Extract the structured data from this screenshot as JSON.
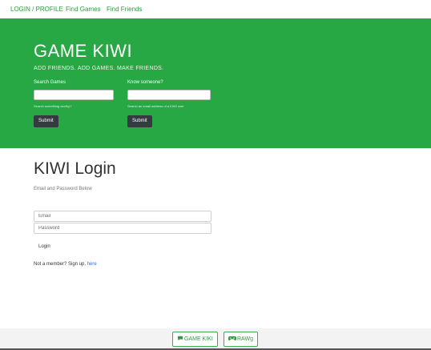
{
  "nav": {
    "items": [
      "LOGIN / PROFILE",
      "Find Games",
      "Find Friends"
    ]
  },
  "hero": {
    "title": "GAME KIWI",
    "subtitle": "ADD FRIENDS. ADD GAMES. MAKE FRIENDS.",
    "search_games": {
      "label": "Search Games",
      "help": "Search something worthy?",
      "submit": "Submit"
    },
    "know_someone": {
      "label": "Know someone?",
      "help": "Search an email address of a KIWI user",
      "submit": "Submit"
    }
  },
  "login": {
    "title": "KIWI Login",
    "subtitle": "Email and Password Below",
    "email_placeholder": "Email",
    "password_placeholder": "Password",
    "login_label": "Login",
    "signup_text": "Not a member? Sign up,",
    "signup_link": "here"
  },
  "footer": {
    "buttons": [
      {
        "label": "GAME KIKI",
        "icon": "chat-icon"
      },
      {
        "label": "RAWg",
        "icon": "gamepad-icon"
      }
    ]
  },
  "colors": {
    "hero_green": "#28a745",
    "nav_link": "#2e9b3e",
    "dark_button": "#343a40",
    "link_blue": "#2f6fd1"
  }
}
